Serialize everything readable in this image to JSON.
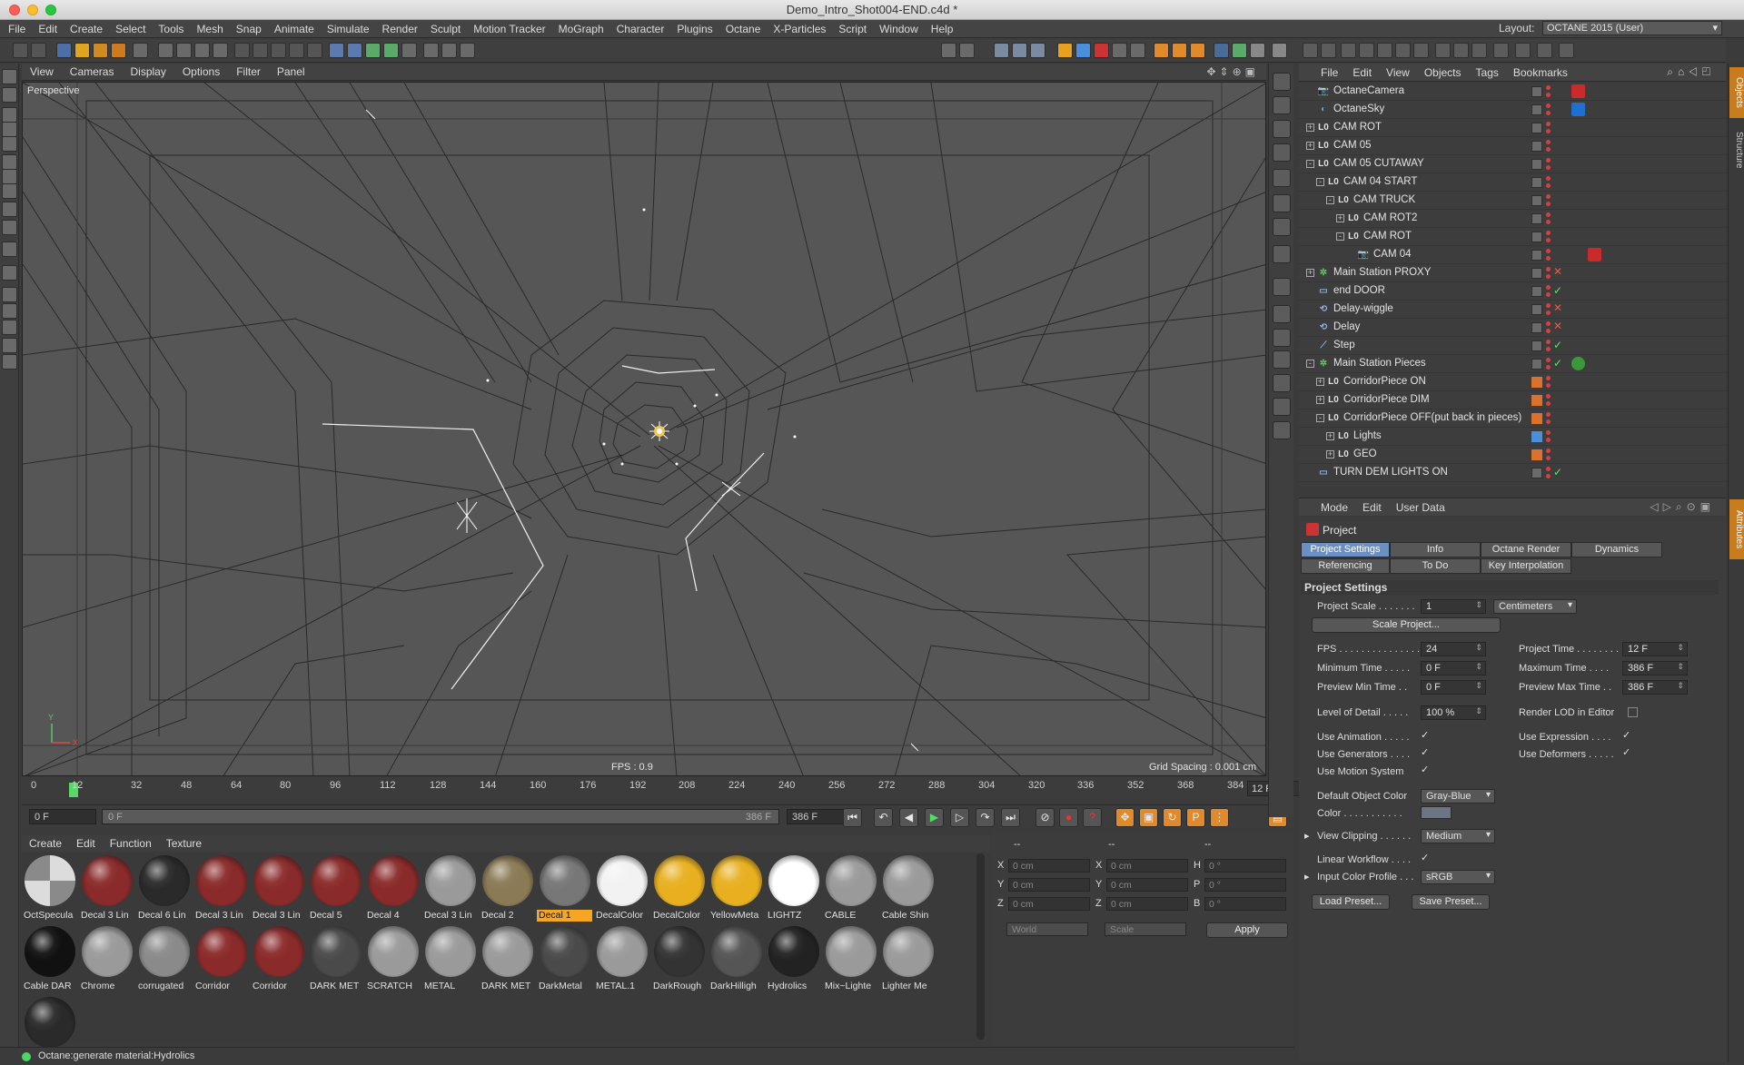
{
  "window": {
    "title": "Demo_Intro_Shot004-END.c4d *"
  },
  "menubar": {
    "items": [
      "File",
      "Edit",
      "Create",
      "Select",
      "Tools",
      "Mesh",
      "Snap",
      "Animate",
      "Simulate",
      "Render",
      "Sculpt",
      "Motion Tracker",
      "MoGraph",
      "Character",
      "Plugins",
      "Octane",
      "X-Particles",
      "Script",
      "Window",
      "Help"
    ],
    "layout_label": "Layout:",
    "layout_value": "OCTANE 2015 (User)"
  },
  "viewport": {
    "menu": [
      "View",
      "Cameras",
      "Display",
      "Options",
      "Filter",
      "Panel"
    ],
    "label": "Perspective",
    "fps": "FPS : 0.9",
    "grid_spacing": "Grid Spacing : 0.001 cm"
  },
  "timeline": {
    "ticks": [
      "0",
      "12",
      "32",
      "48",
      "64",
      "80",
      "96",
      "112",
      "128",
      "144",
      "160",
      "176",
      "192",
      "208",
      "224",
      "240",
      "256",
      "272",
      "288",
      "304",
      "320",
      "336",
      "352",
      "368",
      "384"
    ],
    "current_frame": "12 F",
    "start_field": "0 F",
    "range_start": "0 F",
    "range_end": "386 F",
    "end_field": "386 F"
  },
  "materials": {
    "menu": [
      "Create",
      "Edit",
      "Function",
      "Texture"
    ],
    "items": [
      {
        "name": "OctSpecula",
        "color": "checker"
      },
      {
        "name": "Decal 3 Lin",
        "color": "#8a2a2a"
      },
      {
        "name": "Decal 6 Lin",
        "color": "#2a2a2a"
      },
      {
        "name": "Decal 3 Lin",
        "color": "#8a2a2a"
      },
      {
        "name": "Decal 3 Lin",
        "color": "#8a2a2a"
      },
      {
        "name": "Decal 5",
        "color": "#8a2a2a"
      },
      {
        "name": "Decal 4",
        "color": "#8a2a2a"
      },
      {
        "name": "Decal 3 Lin",
        "color": "#9a9a9a"
      },
      {
        "name": "Decal 2",
        "color": "#8a7a55"
      },
      {
        "name": "Decal 1",
        "color": "#777777",
        "selected": true
      },
      {
        "name": "DecalColor",
        "color": "#f2f2f2"
      },
      {
        "name": "DecalColor",
        "color": "#e8b020"
      },
      {
        "name": "YellowMeta",
        "color": "#e8b020"
      },
      {
        "name": "LIGHTZ",
        "color": "#ffffff"
      },
      {
        "name": "CABLE",
        "color": "#9a9a9a"
      },
      {
        "name": "Cable Shin",
        "color": "#9a9a9a"
      },
      {
        "name": "Cable DAR",
        "color": "#111111"
      },
      {
        "name": "Chrome",
        "color": "#9a9a9a"
      },
      {
        "name": "corrugated",
        "color": "#8a8a8a"
      },
      {
        "name": "Corridor",
        "color": "#8a2a2a"
      },
      {
        "name": "Corridor",
        "color": "#8a2a2a"
      },
      {
        "name": "DARK MET",
        "color": "#4a4a4a"
      },
      {
        "name": "SCRATCH",
        "color": "#9a9a9a"
      },
      {
        "name": "METAL",
        "color": "#9a9a9a"
      },
      {
        "name": "DARK MET",
        "color": "#9a9a9a"
      },
      {
        "name": "DarkMetal",
        "color": "#4a4a4a"
      },
      {
        "name": "METAL.1",
        "color": "#9a9a9a"
      },
      {
        "name": "DarkRough",
        "color": "#333333"
      },
      {
        "name": "DarkHilligh",
        "color": "#555555"
      },
      {
        "name": "Hydrolics",
        "color": "#222222"
      },
      {
        "name": "Mix~Lighte",
        "color": "#9a9a9a"
      },
      {
        "name": "Lighter Me",
        "color": "#9a9a9a"
      },
      {
        "name": "",
        "color": "#2a2a2a"
      }
    ]
  },
  "coords": {
    "headers": [
      "--",
      "--",
      "--"
    ],
    "rows": [
      {
        "axis": "X",
        "pos": "0 cm",
        "axis2": "X",
        "size": "0 cm",
        "rot_label": "H",
        "rot": "0 °"
      },
      {
        "axis": "Y",
        "pos": "0 cm",
        "axis2": "Y",
        "size": "0 cm",
        "rot_label": "P",
        "rot": "0 °"
      },
      {
        "axis": "Z",
        "pos": "0 cm",
        "axis2": "Z",
        "size": "0 cm",
        "rot_label": "B",
        "rot": "0 °"
      }
    ],
    "mode1": "World",
    "mode2": "Scale",
    "apply": "Apply"
  },
  "status": {
    "text": "Octane:generate material:Hydrolics"
  },
  "objects": {
    "menu": [
      "File",
      "Edit",
      "View",
      "Objects",
      "Tags",
      "Bookmarks"
    ],
    "rows": [
      {
        "name": "OctaneCamera",
        "indent": 0,
        "icon": "cam",
        "expander": "",
        "flag": "",
        "tag": "red-cam"
      },
      {
        "name": "OctaneSky",
        "indent": 0,
        "icon": "sky",
        "expander": "",
        "flag": "",
        "tag": "blue-sky"
      },
      {
        "name": "CAM ROT",
        "indent": 0,
        "icon": "null",
        "expander": "+",
        "flag": "",
        "tag": ""
      },
      {
        "name": "CAM 05",
        "indent": 0,
        "icon": "null",
        "expander": "+",
        "flag": "",
        "tag": ""
      },
      {
        "name": "CAM 05 CUTAWAY",
        "indent": 0,
        "icon": "null",
        "expander": "-",
        "flag": "",
        "tag": ""
      },
      {
        "name": "CAM 04 START",
        "indent": 1,
        "icon": "null",
        "expander": "-",
        "flag": "",
        "tag": ""
      },
      {
        "name": "CAM TRUCK",
        "indent": 2,
        "icon": "null",
        "expander": "-",
        "flag": "",
        "tag": ""
      },
      {
        "name": "CAM ROT2",
        "indent": 3,
        "icon": "null",
        "expander": "+",
        "flag": "",
        "tag": ""
      },
      {
        "name": "CAM ROT",
        "indent": 3,
        "icon": "null",
        "expander": "-",
        "flag": "",
        "tag": ""
      },
      {
        "name": "CAM 04",
        "indent": 4,
        "icon": "cam",
        "expander": "",
        "flag": "",
        "tag": "red-cam"
      },
      {
        "name": "Main Station PROXY",
        "indent": 0,
        "icon": "gen",
        "expander": "+",
        "flag": "x",
        "tag": ""
      },
      {
        "name": "end DOOR",
        "indent": 0,
        "icon": "plane",
        "expander": "",
        "flag": "check",
        "tag": ""
      },
      {
        "name": "Delay-wiggle",
        "indent": 0,
        "icon": "eff",
        "expander": "",
        "flag": "x",
        "tag": ""
      },
      {
        "name": "Delay",
        "indent": 0,
        "icon": "eff",
        "expander": "",
        "flag": "x",
        "tag": ""
      },
      {
        "name": "Step",
        "indent": 0,
        "icon": "step",
        "expander": "",
        "flag": "check",
        "tag": ""
      },
      {
        "name": "Main Station Pieces",
        "indent": 0,
        "icon": "gen",
        "expander": "-",
        "flag": "check",
        "tag": "green"
      },
      {
        "name": "CorridorPiece ON",
        "indent": 1,
        "icon": "null",
        "expander": "+",
        "flag": "",
        "tag": "",
        "layer": "#d9722c"
      },
      {
        "name": "CorridorPiece DIM",
        "indent": 1,
        "icon": "null",
        "expander": "+",
        "flag": "",
        "tag": "",
        "layer": "#d9722c"
      },
      {
        "name": "CorridorPiece OFF(put back in pieces)",
        "indent": 1,
        "icon": "null",
        "expander": "-",
        "flag": "",
        "tag": "",
        "layer": "#d9722c"
      },
      {
        "name": "Lights",
        "indent": 2,
        "icon": "null",
        "expander": "+",
        "flag": "",
        "tag": "",
        "layer": "#4a8fd9"
      },
      {
        "name": "GEO",
        "indent": 2,
        "icon": "null",
        "expander": "+",
        "flag": "",
        "tag": "",
        "layer": "#d9722c"
      },
      {
        "name": "TURN DEM LIGHTS ON",
        "indent": 0,
        "icon": "plane",
        "expander": "",
        "flag": "check",
        "tag": ""
      }
    ]
  },
  "attributes": {
    "menu": [
      "Mode",
      "Edit",
      "User Data"
    ],
    "title": "Project",
    "tabs_row1": [
      "Project Settings",
      "Info",
      "Octane Render",
      "Dynamics"
    ],
    "tabs_row2": [
      "Referencing",
      "To Do",
      "Key Interpolation"
    ],
    "section": "Project Settings",
    "project_scale_label": "Project Scale . . . . . . .",
    "project_scale": "1",
    "project_scale_unit": "Centimeters",
    "scale_button": "Scale Project...",
    "fps_label": "FPS . . . . . . . . . . . . . . .",
    "fps": "24",
    "project_time_label": "Project Time . . . . . . . .",
    "project_time": "12 F",
    "min_time_label": "Minimum Time . . . . .",
    "min_time": "0 F",
    "max_time_label": "Maximum Time . . . .",
    "max_time": "386 F",
    "prev_min_label": "Preview Min Time . .",
    "prev_min": "0 F",
    "prev_max_label": "Preview Max Time . .",
    "prev_max": "386 F",
    "lod_label": "Level of Detail . . . . .",
    "lod": "100 %",
    "render_lod_label": "Render LOD in Editor",
    "use_animation_label": "Use Animation . . . . .",
    "use_expression_label": "Use Expression . . . .",
    "use_generators_label": "Use Generators . . . .",
    "use_deformers_label": "Use Deformers . . . . .",
    "use_motion_label": "Use Motion System",
    "default_color_label": "Default Object Color",
    "default_color": "Gray-Blue",
    "color_label": "Color . . . . . . . . . . .",
    "view_clipping_label": "View Clipping . . . . . .",
    "view_clipping": "Medium",
    "linear_workflow_label": "Linear Workflow . . . .",
    "input_profile_label": "Input Color Profile . . .",
    "input_profile": "sRGB",
    "load_preset": "Load Preset...",
    "save_preset": "Save Preset..."
  },
  "side_tabs": [
    "Objects",
    "Structure",
    "Attributes"
  ]
}
